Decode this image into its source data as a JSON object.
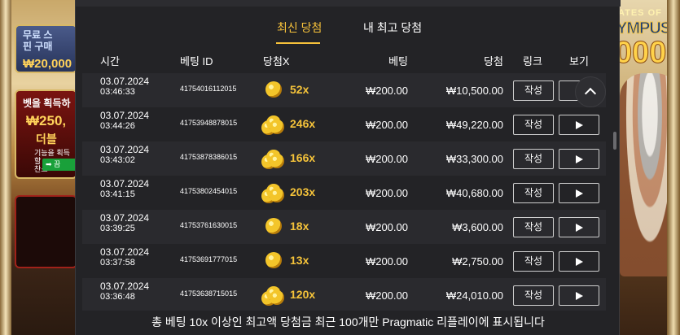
{
  "background": {
    "left_panel1_text": "무료 스",
    "left_panel1_sub": "핀 구매",
    "left_panel1_value": "₩20,000",
    "left_panel2_title": "벳을 획득하",
    "left_panel2_value": "₩250,",
    "left_panel2_sub": "더블",
    "left_panel2_note1": "기능을 획득할",
    "left_panel2_note2": "찬스",
    "left_panel2_btn": "끔",
    "right_logo_top": "ATES OF",
    "right_logo_main": "YMPUS",
    "right_logo_big": "000"
  },
  "tabs": [
    {
      "label": "최신 당첨",
      "active": true
    },
    {
      "label": "내 최고 당첨",
      "active": false
    }
  ],
  "headers": {
    "time": "시간",
    "bet_id": "베팅 ID",
    "multiplier": "당첨X",
    "bet": "베팅",
    "win": "당첨",
    "link": "링크",
    "view": "보기"
  },
  "rows": [
    {
      "date": "03.07.2024",
      "time": "03:46:33",
      "bet_id": "41754016112015",
      "multiplier": "52x",
      "bet": "₩200.00",
      "win": "₩10,500.00",
      "link_label": "작성",
      "coin": "single"
    },
    {
      "date": "03.07.2024",
      "time": "03:44:26",
      "bet_id": "41753948878015",
      "multiplier": "246x",
      "bet": "₩200.00",
      "win": "₩49,220.00",
      "link_label": "작성",
      "coin": "stack"
    },
    {
      "date": "03.07.2024",
      "time": "03:43:02",
      "bet_id": "41753878386015",
      "multiplier": "166x",
      "bet": "₩200.00",
      "win": "₩33,300.00",
      "link_label": "작성",
      "coin": "stack"
    },
    {
      "date": "03.07.2024",
      "time": "03:41:15",
      "bet_id": "41753802454015",
      "multiplier": "203x",
      "bet": "₩200.00",
      "win": "₩40,680.00",
      "link_label": "작성",
      "coin": "stack"
    },
    {
      "date": "03.07.2024",
      "time": "03:39:25",
      "bet_id": "41753761630015",
      "multiplier": "18x",
      "bet": "₩200.00",
      "win": "₩3,600.00",
      "link_label": "작성",
      "coin": "single"
    },
    {
      "date": "03.07.2024",
      "time": "03:37:58",
      "bet_id": "41753691777015",
      "multiplier": "13x",
      "bet": "₩200.00",
      "win": "₩2,750.00",
      "link_label": "작성",
      "coin": "single"
    },
    {
      "date": "03.07.2024",
      "time": "03:36:48",
      "bet_id": "41753638715015",
      "multiplier": "120x",
      "bet": "₩200.00",
      "win": "₩24,010.00",
      "link_label": "작성",
      "coin": "stack"
    }
  ],
  "footer": {
    "note": "총 베팅 10x 이상인 최고액 당첨금 최근 100개만 Pragmatic 리플레이에 표시됩니다"
  },
  "colors": {
    "accent": "#f6c13b",
    "panel_bg": "#232326",
    "row_alt_bg": "#2a2a2e",
    "multiplier": "#f5c33a"
  },
  "icons": {
    "play": "play-icon",
    "scroll_up": "chevron-up-icon",
    "coin_single": "coin-icon",
    "coin_stack": "coin-stack-icon"
  }
}
